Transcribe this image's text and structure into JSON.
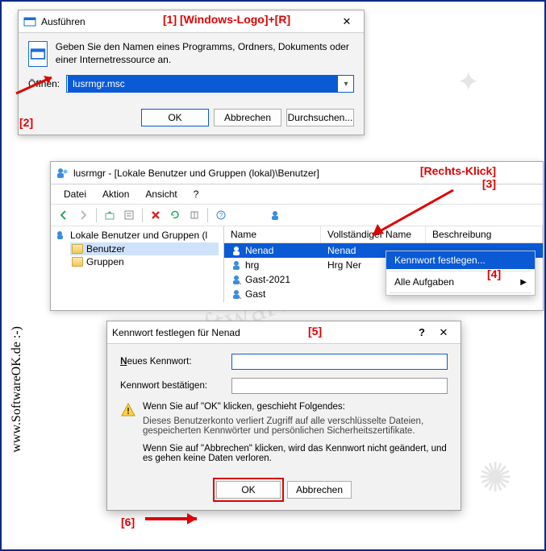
{
  "watermark": {
    "sidebar": "www.SoftwareOK.de :-)",
    "diagonal": "SoftwareOK.de"
  },
  "annotations": {
    "a1": "[1] [Windows-Logo]+[R]",
    "a2": "[2]",
    "a3_label": "[Rechts-Klick]",
    "a3_num": "[3]",
    "a4": "[4]",
    "a5": "[5]",
    "a6": "[6]"
  },
  "run": {
    "title": "Ausführen",
    "desc": "Geben Sie den Namen eines Programms, Ordners, Dokuments oder einer Internetressource an.",
    "open_label": "Öffnen:",
    "value": "lusrmgr.msc",
    "ok": "OK",
    "cancel": "Abbrechen",
    "browse": "Durchsuchen..."
  },
  "mmc": {
    "title": "lusrmgr - [Lokale Benutzer und Gruppen (lokal)\\Benutzer]",
    "menu": {
      "file": "Datei",
      "action": "Aktion",
      "view": "Ansicht",
      "help": "?"
    },
    "tree": {
      "root": "Lokale Benutzer und Gruppen (l",
      "users": "Benutzer",
      "groups": "Gruppen"
    },
    "columns": {
      "name": "Name",
      "fullname": "Vollständiger Name",
      "desc": "Beschreibung"
    },
    "rows": [
      {
        "name": "Nenad",
        "full": "Nenad"
      },
      {
        "name": "hrg",
        "full": "Hrg Ner"
      },
      {
        "name": "Gast-2021",
        "full": ""
      },
      {
        "name": "Gast",
        "full": ""
      }
    ],
    "context": {
      "set_pw": "Kennwort festlegen...",
      "all_tasks": "Alle Aufgaben"
    }
  },
  "pw": {
    "title": "Kennwort festlegen für Nenad",
    "new_pw": "Neues Kennwort:",
    "confirm": "Kennwort bestätigen:",
    "warn_intro": "Wenn Sie auf \"OK\" klicken, geschieht Folgendes:",
    "warn_body": "Dieses Benutzerkonto verliert Zugriff auf alle verschlüsselte Dateien, gespeicherten Kennwörter und persönlichen Sicherheitszertifikate.",
    "warn_cancel": "Wenn Sie auf \"Abbrechen\" klicken, wird das Kennwort nicht geändert, und es gehen keine Daten verloren.",
    "ok": "OK",
    "cancel": "Abbrechen"
  }
}
